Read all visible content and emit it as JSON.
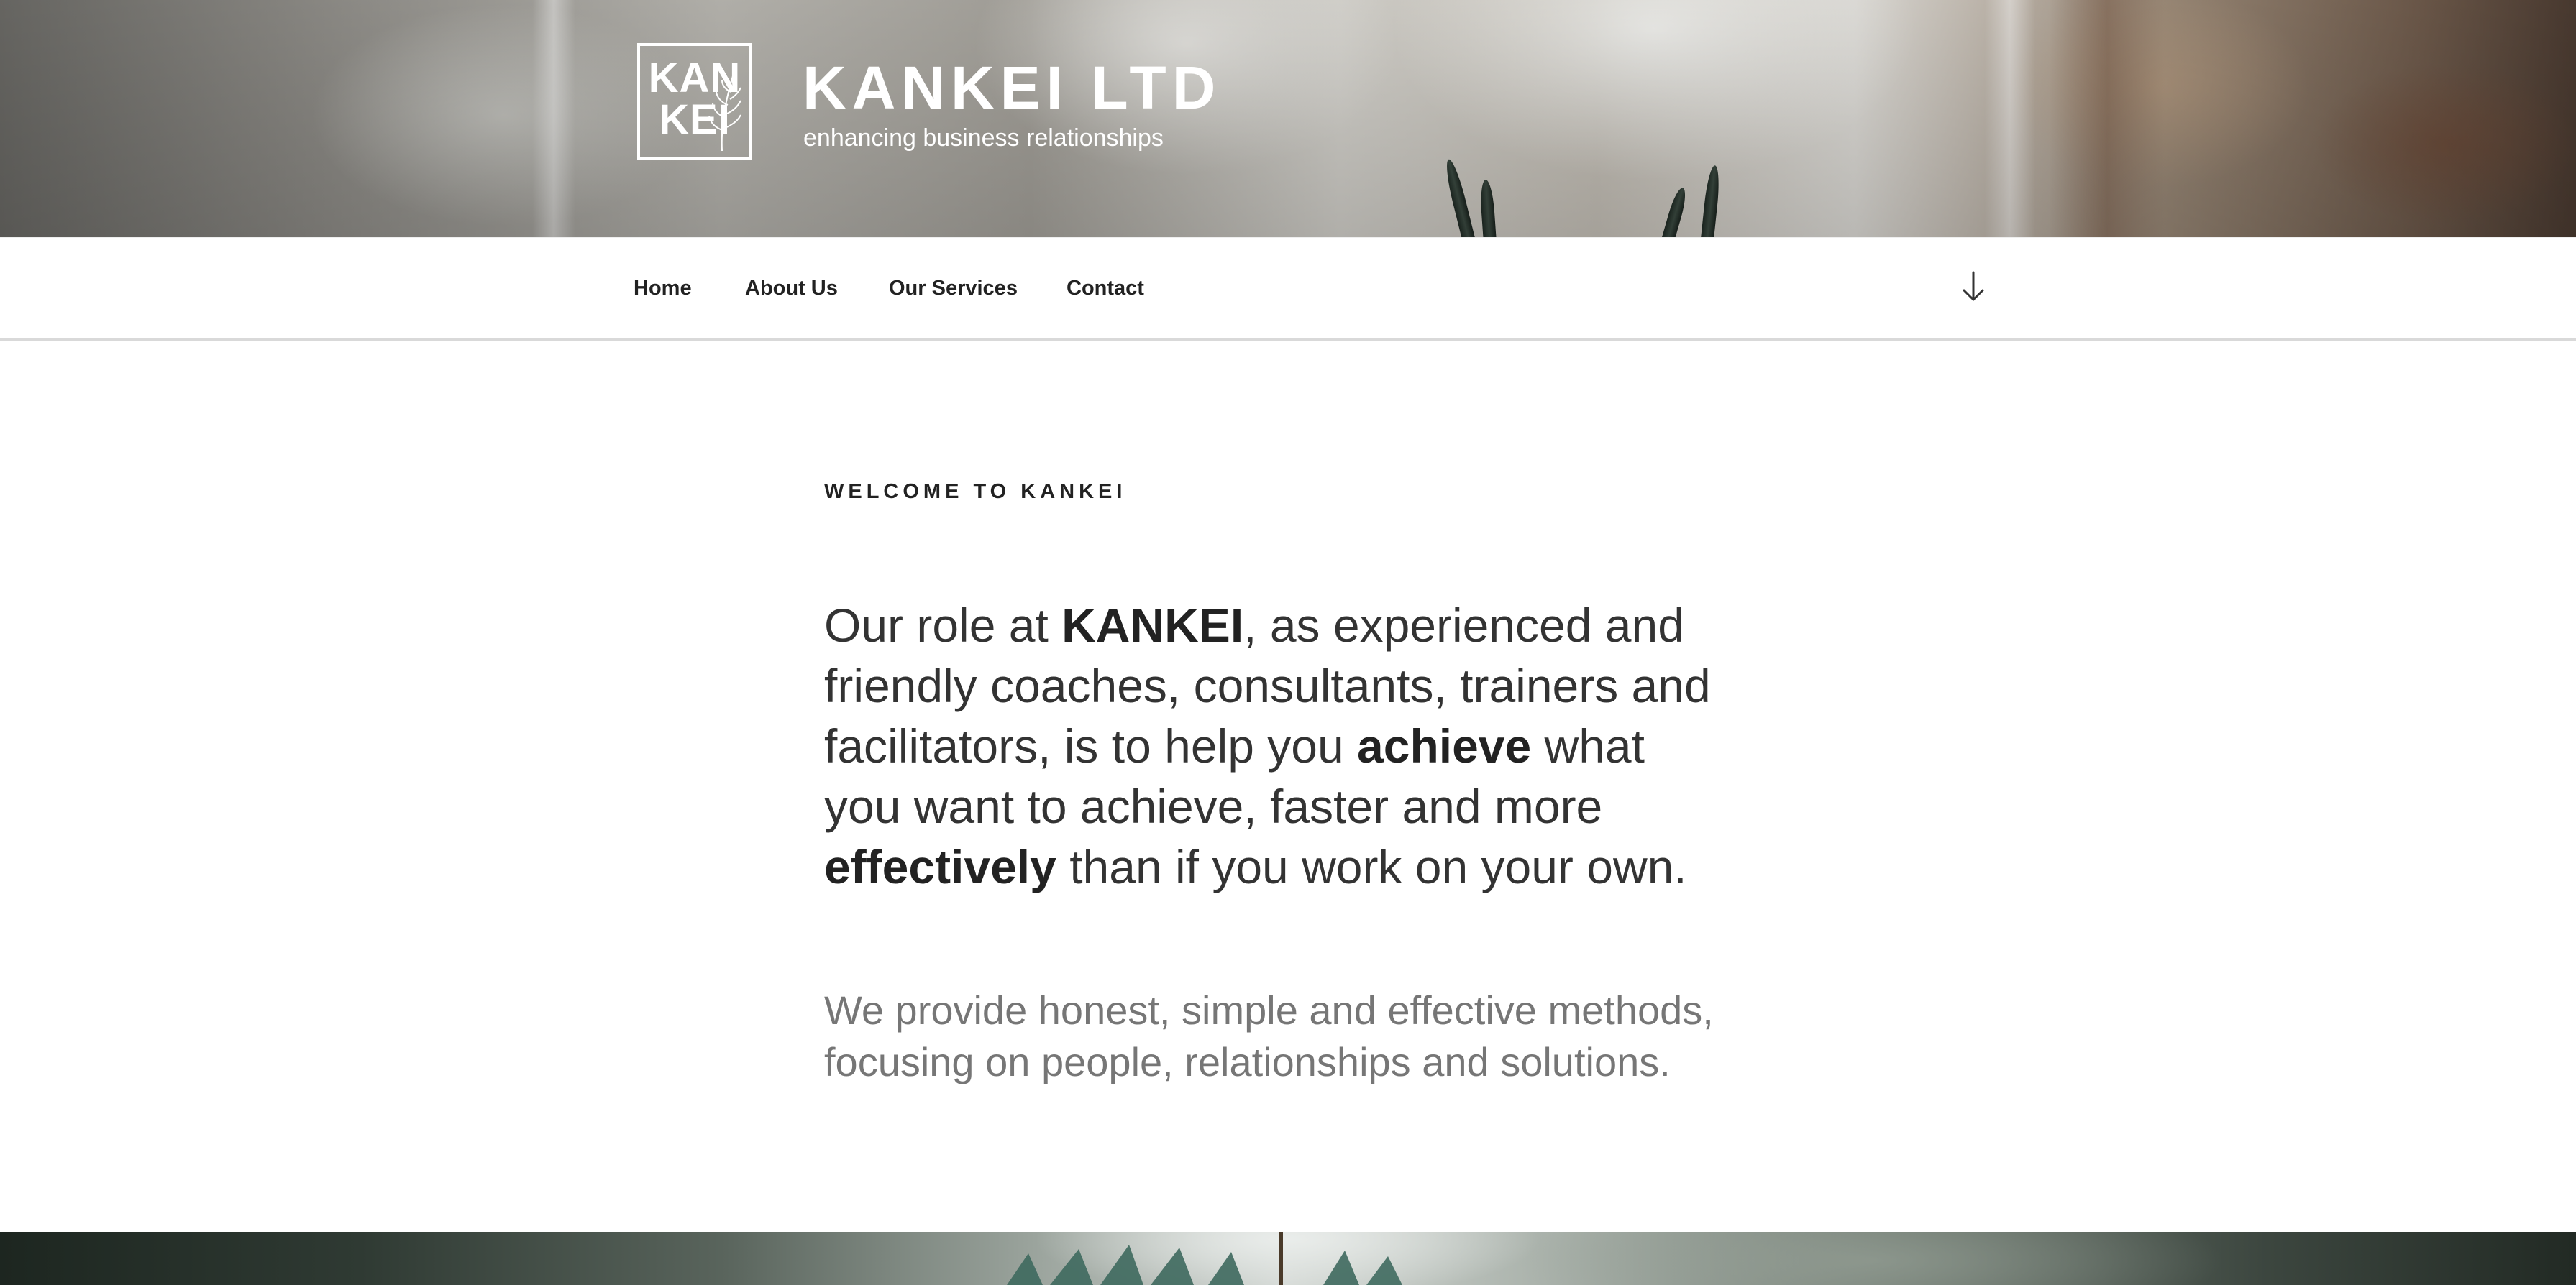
{
  "site": {
    "logo_text_line1": "KAN",
    "logo_text_line2": "KEI",
    "title": "KANKEI LTD",
    "tagline": "enhancing business relationships"
  },
  "nav": {
    "items": [
      {
        "label": "Home"
      },
      {
        "label": "About Us"
      },
      {
        "label": "Our Services"
      },
      {
        "label": "Contact"
      }
    ],
    "scroll_icon": "arrow-down-icon"
  },
  "content": {
    "kicker": "WELCOME TO KANKEI",
    "lead": {
      "p1": "Our role at ",
      "b1": "KANKEI",
      "p2": ", as experienced and friendly coaches, consultants, trainers and facilitators, is to help you ",
      "b2": "achieve",
      "p3": " what you want to achieve, faster and more ",
      "b3": "effectively",
      "p4": " than if you work on your own."
    },
    "sub": "We provide honest, simple and effective methods, focusing on people, relationships and solutions."
  },
  "colors": {
    "text_dark": "#333333",
    "text_muted": "#767676",
    "nav_border": "#d9d9d9"
  }
}
